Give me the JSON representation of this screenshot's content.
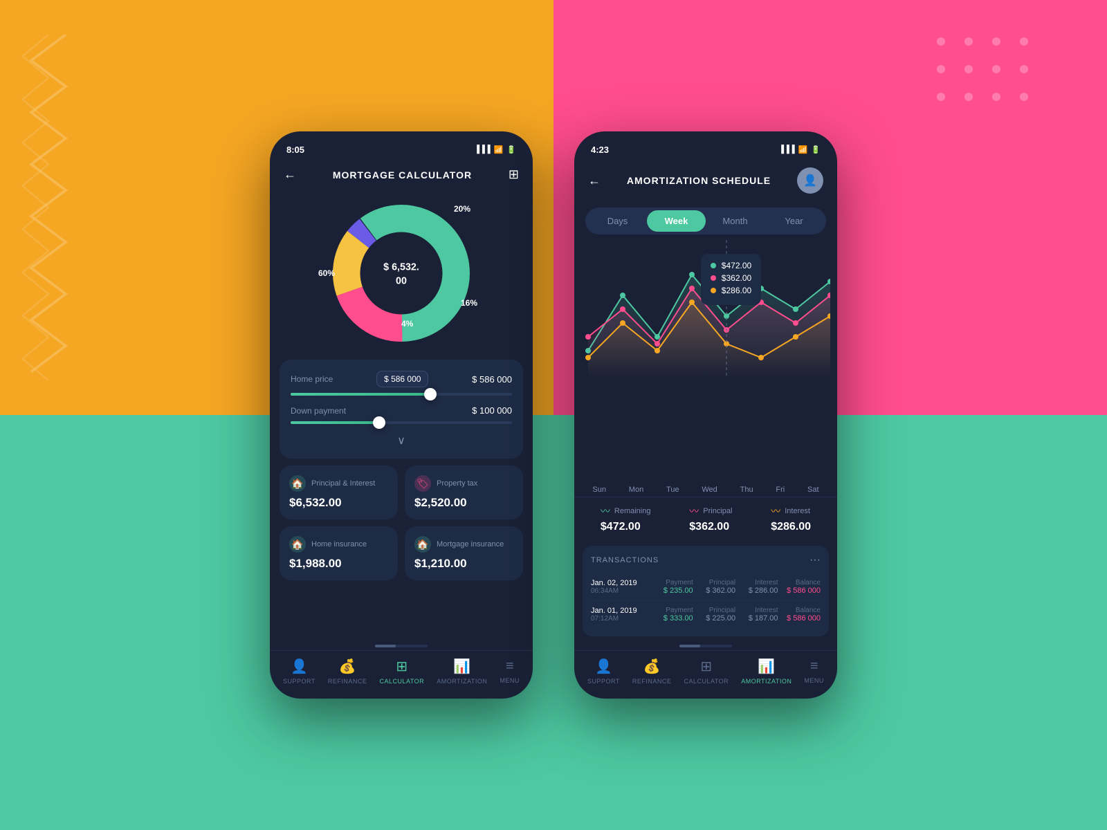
{
  "backgrounds": {
    "left_top": "#F5A623",
    "left_bottom": "#4DC8A0",
    "right_top": "#FF4D8D",
    "right_bottom": "#4DC8A0"
  },
  "phone1": {
    "status_time": "8:05",
    "header_title": "MORTGAGE CALCULATOR",
    "donut": {
      "center_amount": "$ 6,532. 00",
      "label_60": "60%",
      "label_20": "20%",
      "label_16": "16%",
      "label_4": "4%"
    },
    "inputs": {
      "home_price_label": "Home price",
      "home_price_badge": "$ 586 000",
      "home_price_value": "$ 586 000",
      "down_payment_label": "Down payment",
      "down_payment_value": "$ 100 000"
    },
    "cards": [
      {
        "label": "Principal & Interest",
        "value": "$6,532.00",
        "color": "#4DC8A0"
      },
      {
        "label": "Property tax",
        "value": "$2,520.00",
        "color": "#FF6B9D"
      },
      {
        "label": "Home insurance",
        "value": "$1,988.00",
        "color": "#4DC8A0"
      },
      {
        "label": "Mortgage insurance",
        "value": "$1,210.00",
        "color": "#4DC8A0"
      }
    ],
    "nav": [
      {
        "label": "SUPPORT",
        "active": false
      },
      {
        "label": "REFINANCE",
        "active": false
      },
      {
        "label": "CALCULATOR",
        "active": true
      },
      {
        "label": "AMORTIZATION",
        "active": false
      },
      {
        "label": "MENU",
        "active": false
      }
    ]
  },
  "phone2": {
    "status_time": "4:23",
    "header_title": "AMORTIZATION SCHEDULE",
    "period_tabs": [
      {
        "label": "Days",
        "active": false
      },
      {
        "label": "Week",
        "active": true
      },
      {
        "label": "Month",
        "active": false
      },
      {
        "label": "Year",
        "active": false
      }
    ],
    "chart": {
      "x_axis": [
        "Sun",
        "Mon",
        "Tue",
        "Wed",
        "Thu",
        "Fri",
        "Sat"
      ],
      "tooltip": {
        "remaining": "$472.00",
        "principal": "$362.00",
        "interest": "$286.00"
      }
    },
    "legend": [
      {
        "label": "Remaining",
        "value": "$472.00",
        "color": "#4DC8A0"
      },
      {
        "label": "Principal",
        "value": "$362.00",
        "color": "#FF4D8D"
      },
      {
        "label": "Interest",
        "value": "$286.00",
        "color": "#F5A623"
      }
    ],
    "transactions": {
      "title": "TRANSACTIONS",
      "rows": [
        {
          "date": "Jan. 02, 2019",
          "time": "06:34AM",
          "payment": "$ 235.00",
          "principal": "$ 362.00",
          "interest": "$ 286.00",
          "balance": "$ 586 000"
        },
        {
          "date": "Jan. 01, 2019",
          "time": "07:12AM",
          "payment": "$ 333.00",
          "principal": "$ 225.00",
          "interest": "$ 187.00",
          "balance": "$ 586 000"
        }
      ]
    },
    "nav": [
      {
        "label": "SUPPORT",
        "active": false
      },
      {
        "label": "REFINANCE",
        "active": false
      },
      {
        "label": "CALCULATOR",
        "active": false
      },
      {
        "label": "AMORTIZATION",
        "active": true
      },
      {
        "label": "MENU",
        "active": false
      }
    ]
  }
}
